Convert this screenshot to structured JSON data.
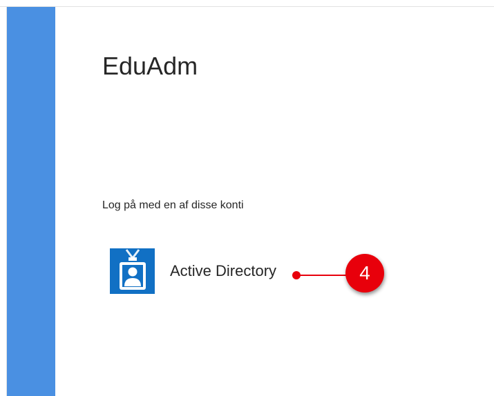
{
  "app": {
    "title": "EduAdm"
  },
  "signin": {
    "prompt": "Log på med en af disse konti",
    "providers": [
      {
        "label": "Active Directory",
        "icon": "id-badge-icon"
      }
    ]
  },
  "annotation": {
    "number": "4"
  },
  "colors": {
    "sidebar": "#4a90e2",
    "icon_bg": "#1170c4",
    "callout": "#e8000b"
  }
}
